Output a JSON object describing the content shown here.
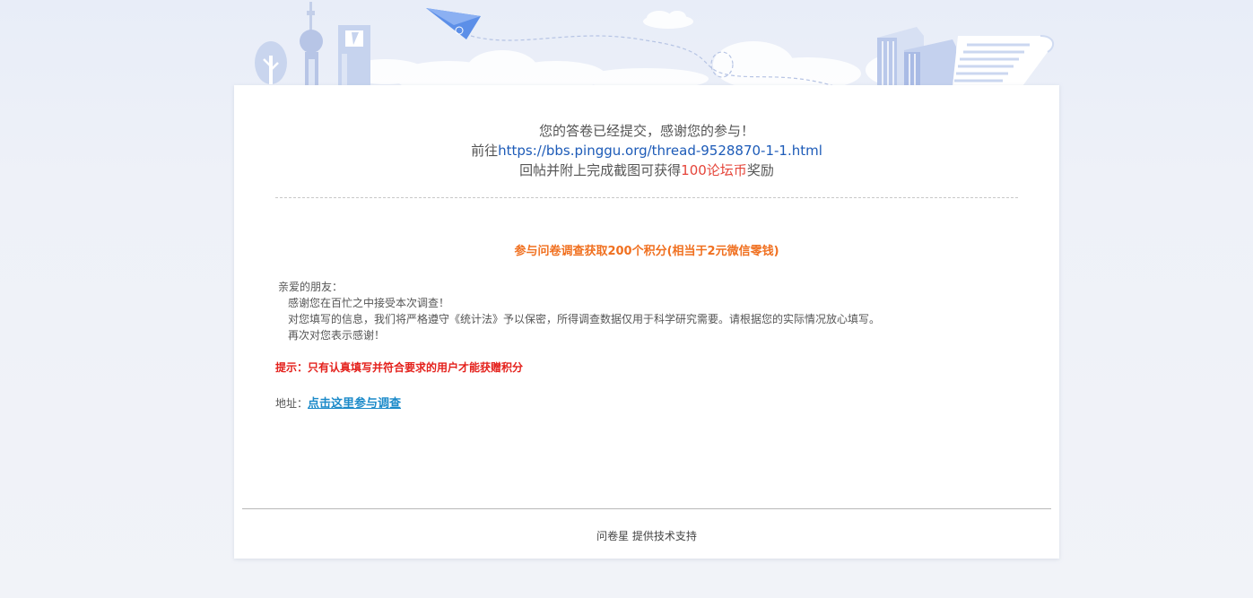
{
  "confirmation": {
    "line1": "您的答卷已经提交，感谢您的参与！",
    "line2_prefix": "前往",
    "line2_link": "https://bbs.pinggu.org/thread-9528870-1-1.html",
    "line3_prefix": "回帖并附上完成截图可获得",
    "line3_reward": "100论坛币",
    "line3_suffix": "奖励"
  },
  "survey": {
    "headline": "参与问卷调查获取200个积分(相当于2元微信零钱)",
    "greeting": "亲爱的朋友：",
    "paragraph1": "感谢您在百忙之中接受本次调查！",
    "paragraph2": "对您填写的信息，我们将严格遵守《统计法》予以保密，所得调查数据仅用于科学研究需要。请根据您的实际情况放心填写。",
    "paragraph3": "再次对您表示感谢！",
    "tip": "提示：只有认真填写并符合要求的用户才能获赠积分",
    "address_label": "地址：",
    "address_link": "点击这里参与调查"
  },
  "footer": {
    "text": "问卷星 提供技术支持"
  },
  "colors": {
    "link_blue": "#1d5bb8",
    "reward_red": "#e5453a",
    "headline_orange": "#f07020",
    "tip_red": "#e4211c",
    "address_link": "#1b8ac9"
  }
}
